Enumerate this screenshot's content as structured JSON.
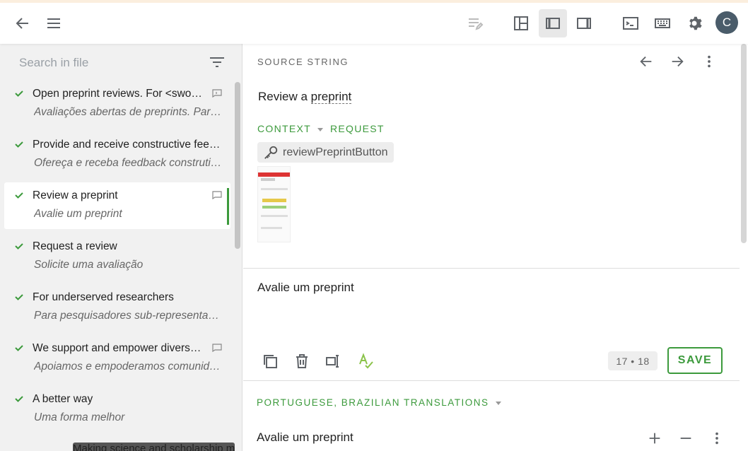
{
  "topbar": {
    "icons": [
      "back-arrow-icon",
      "menu-icon",
      "edit-list-icon",
      "layout-quad-icon",
      "layout-left-icon",
      "layout-right-icon",
      "terminal-icon",
      "keyboard-icon",
      "gear-icon"
    ],
    "avatar_letter": "C"
  },
  "sidebar": {
    "search_placeholder": "Search in file",
    "items": [
      {
        "source": "Open preprint reviews. For <swo…",
        "translation": "Avaliações abertas de preprints. Par…",
        "has_comment": true
      },
      {
        "source": "Provide and receive constructive fee…",
        "translation": "Ofereça e receba feedback construti…",
        "has_comment": false
      },
      {
        "source": "Review a preprint",
        "translation": "Avalie um preprint",
        "has_comment": true,
        "selected": true
      },
      {
        "source": "Request a review",
        "translation": "Solicite uma avaliação",
        "has_comment": false
      },
      {
        "source": "For underserved researchers",
        "translation": "Para pesquisadores sub-representad…",
        "has_comment": false
      },
      {
        "source": "We support and empower divers…",
        "translation": "Apoiamos e empoderamos comunid…",
        "has_comment": true
      },
      {
        "source": "A better way",
        "translation": "Uma forma melhor",
        "has_comment": false
      }
    ],
    "tooltip": "Making science and scholarship mo"
  },
  "source_panel": {
    "label": "SOURCE STRING",
    "text_plain": "Review a ",
    "text_dotted": "preprint",
    "context_label": "CONTEXT",
    "request_label": "REQUEST",
    "key": "reviewPreprintButton"
  },
  "editor": {
    "text": "Avalie um preprint",
    "counter": "17 • 18",
    "save_label": "SAVE"
  },
  "translations": {
    "label": "PORTUGUESE, BRAZILIAN TRANSLATIONS",
    "first": "Avalie um preprint"
  },
  "colors": {
    "accent_green": "#3c9a3c",
    "avatar_bg": "#4a5c6a"
  }
}
